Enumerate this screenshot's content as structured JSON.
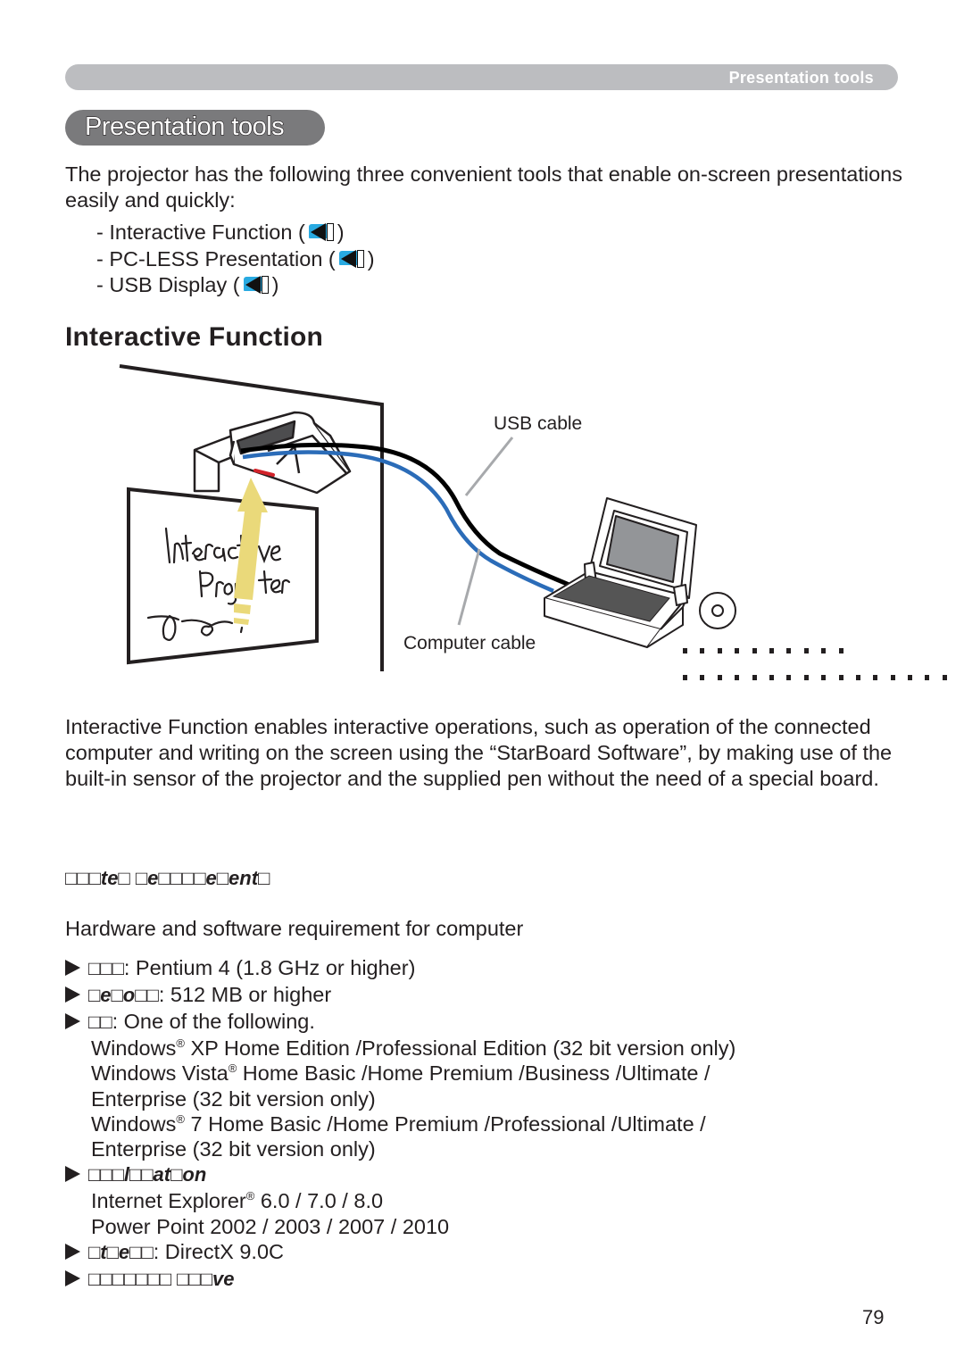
{
  "header": {
    "running_title": "Presentation tools"
  },
  "section": {
    "title": "Presentation tools"
  },
  "intro": {
    "text": "The projector has the following three convenient tools that enable on-screen presentations easily and quickly:",
    "tools": [
      {
        "label": "- Interactive Function (",
        "close": ")",
        "icon": "book-reference-icon"
      },
      {
        "label": "- PC-LESS Presentation (",
        "close": ")",
        "icon": "book-reference-icon"
      },
      {
        "label": "- USB Display (",
        "close": ")",
        "icon": "book-reference-icon"
      }
    ]
  },
  "interactive": {
    "heading": "Interactive Function",
    "diagram": {
      "usb_cable_label": "USB cable",
      "computer_cable_label": "Computer cable",
      "board_text_line1": "Interactive",
      "board_text_line2": "Projector",
      "colors": {
        "usb_cable": "#000000",
        "computer_cable": "#2b6cb8",
        "pen_beam": "#ead97a",
        "leader_line": "#a7a9ac",
        "laptop_screen": "#939598"
      }
    },
    "description": "Interactive Function enables interactive operations, such as operation of the connected computer and writing on the screen using the “StarBoard Software”, by making use of the built-in sensor of the projector and the supplied pen without the need of a special board.",
    "system_requirements_heading": "□□□te□ □e□□□□e□ent□",
    "hw_sw_intro": "Hardware and software requirement for computer",
    "requirements": [
      {
        "key": "□□□",
        "value": ": Pentium 4 (1.8 GHz or higher)"
      },
      {
        "key": "□e□o□□",
        "value": ": 512 MB or higher"
      },
      {
        "key": "□□",
        "value": ": One of the following."
      }
    ],
    "os_list": [
      {
        "pre": "Windows",
        "sup": "®",
        "post": " XP Home Edition /Professional Edition (32 bit version only)"
      },
      {
        "pre": "Windows Vista",
        "sup": "®",
        "post": " Home Basic /Home Premium /Business /Ultimate /"
      },
      {
        "pre": "Enterprise (32 bit version only)",
        "sup": "",
        "post": ""
      },
      {
        "pre": "Windows",
        "sup": "®",
        "post": " 7 Home Basic /Home Premium /Professional /Ultimate /"
      },
      {
        "pre": "Enterprise (32 bit version only)",
        "sup": "",
        "post": ""
      }
    ],
    "application": {
      "key": "□□□l□□at□on",
      "items": [
        {
          "pre": "Internet Explorer",
          "sup": "®",
          "post": " 6.0 / 7.0 / 8.0"
        },
        {
          "pre": "Power Point 2002 / 2003 / 2007 / 2010",
          "sup": "",
          "post": ""
        }
      ]
    },
    "other": {
      "key": "□t□e□□",
      "value": ": DirectX 9.0C"
    },
    "last": {
      "key": "□□□□□□□ □□□ve"
    }
  },
  "footer": {
    "page_number": "79"
  }
}
